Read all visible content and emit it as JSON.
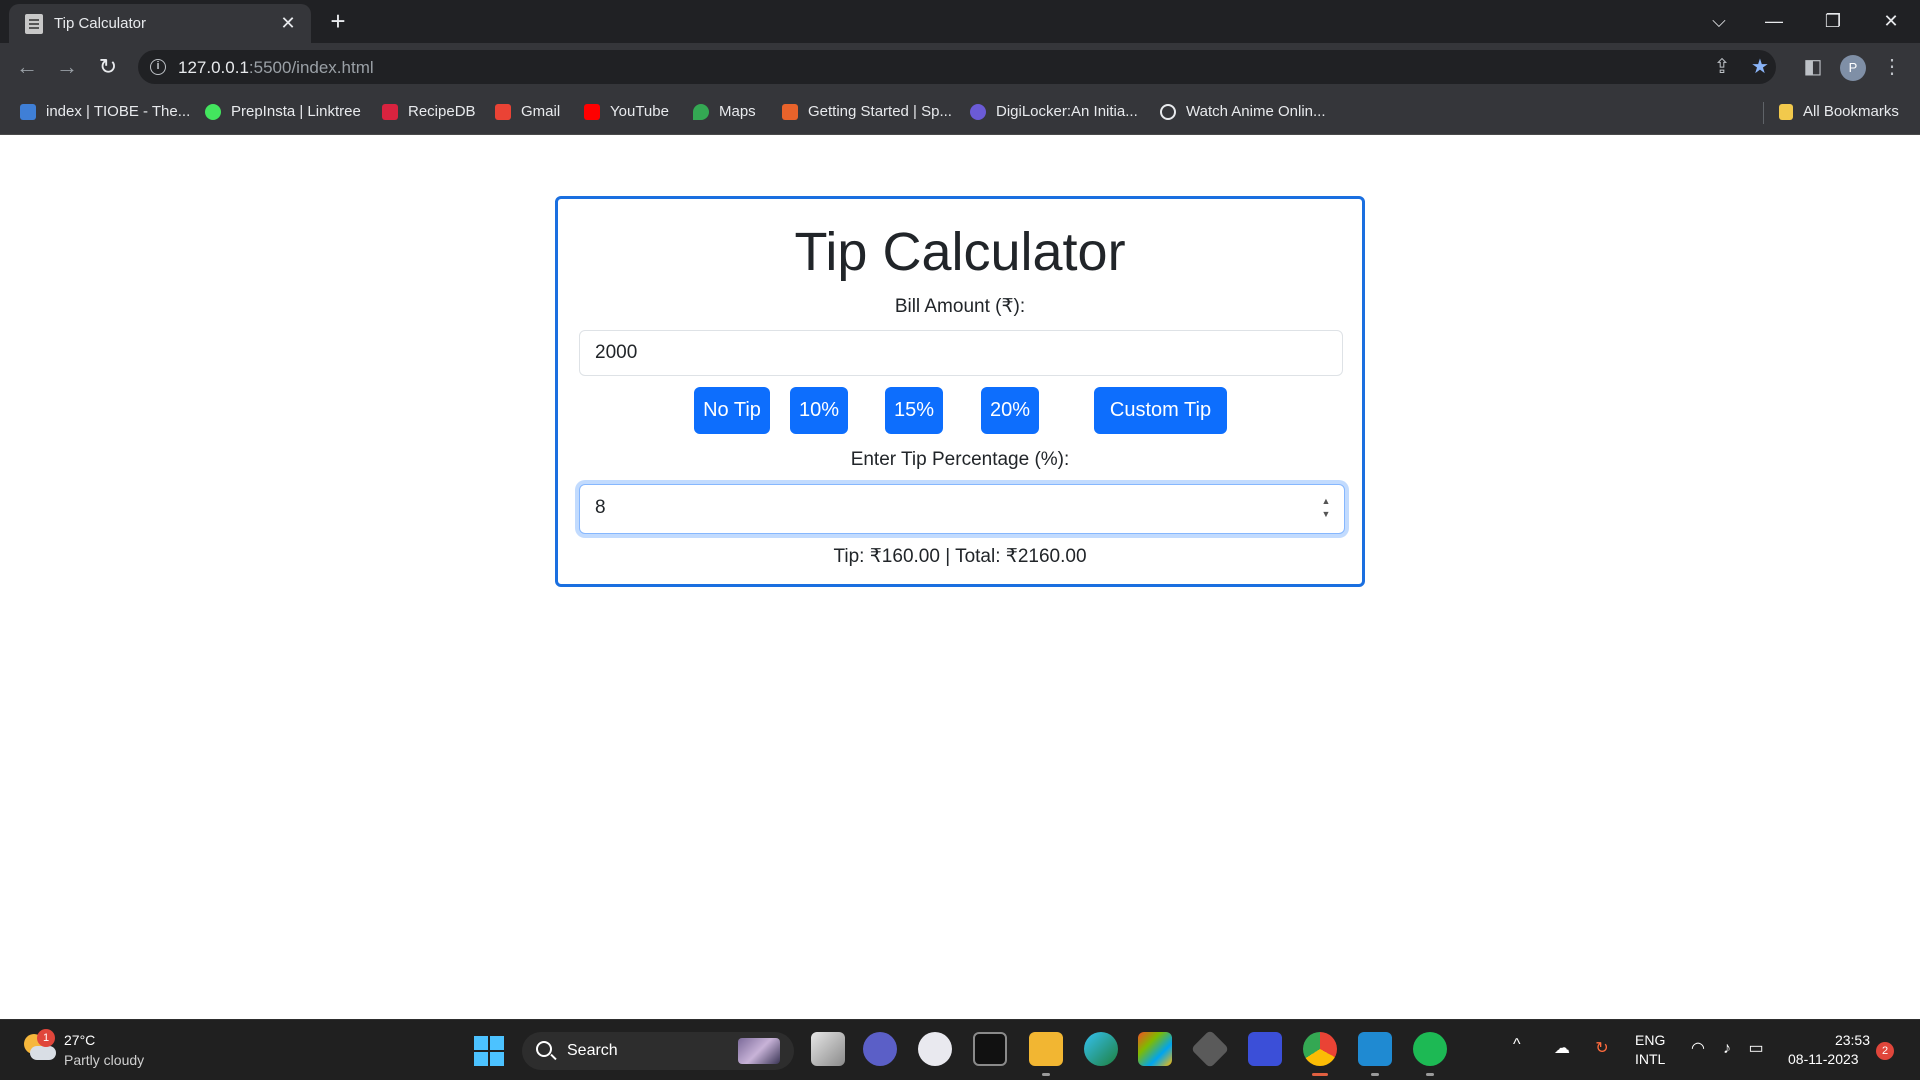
{
  "browser": {
    "tab_title": "Tip Calculator",
    "tab_close": "✕",
    "new_tab": "+",
    "url_host": "127.0.0.1",
    "url_path": ":5500/index.html",
    "bookmarks": [
      {
        "label": "index | TIOBE - The...",
        "icon": "tiobe-icon",
        "color": "#3f7fd6"
      },
      {
        "label": "PrepInsta | Linktree",
        "icon": "linktree-icon",
        "color": "#43e55e"
      },
      {
        "label": "RecipeDB",
        "icon": "recipedb-icon",
        "color": "#d9233f"
      },
      {
        "label": "Gmail",
        "icon": "gmail-icon",
        "color": "#ea4335"
      },
      {
        "label": "YouTube",
        "icon": "youtube-icon",
        "color": "#ff0000"
      },
      {
        "label": "Maps",
        "icon": "maps-icon",
        "color": "#34a853"
      },
      {
        "label": "Getting Started | Sp...",
        "icon": "spring-icon",
        "color": "#e8632b"
      },
      {
        "label": "DigiLocker:An Initia...",
        "icon": "digilocker-icon",
        "color": "#6b5bd6"
      },
      {
        "label": "Watch Anime Onlin...",
        "icon": "anime-icon",
        "color": "#e8eaed"
      }
    ],
    "all_bookmarks": "All Bookmarks",
    "profile_initial": "P"
  },
  "app": {
    "title": "Tip Calculator",
    "bill_label": "Bill Amount (₹):",
    "bill_value": "2000",
    "tip_buttons": [
      "No Tip",
      "10%",
      "15%",
      "20%",
      "Custom Tip"
    ],
    "tip_pct_label": "Enter Tip Percentage (%):",
    "tip_pct_value": "8",
    "result": "Tip: ₹160.00 | Total: ₹2160.00",
    "accent_color": "#0d6efd"
  },
  "taskbar": {
    "weather_badge": "1",
    "temperature": "27°C",
    "weather": "Partly cloudy",
    "search_label": "Search",
    "lang_line1": "ENG",
    "lang_line2": "INTL",
    "time": "23:53",
    "date": "08-11-2023",
    "notification_count": "2"
  }
}
